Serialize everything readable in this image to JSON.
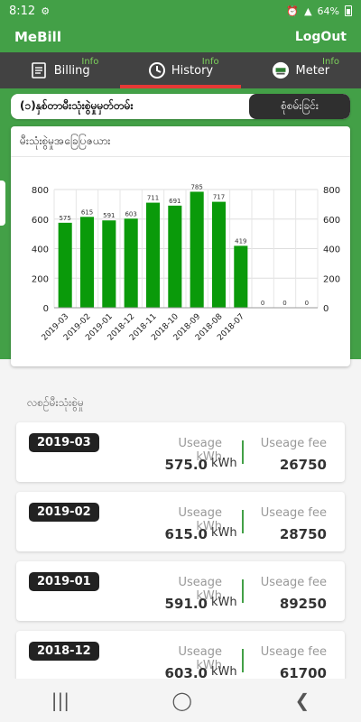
{
  "status": {
    "time": "8:12",
    "battery": "64%"
  },
  "app": {
    "title": "MeBill",
    "logout": "LogOut"
  },
  "tabs": [
    {
      "label": "Billing",
      "badge": "Info",
      "icon": "billing-icon"
    },
    {
      "label": "History",
      "badge": "Info",
      "icon": "history-icon",
      "active": true
    },
    {
      "label": "Meter",
      "badge": "Info",
      "icon": "meter-icon"
    }
  ],
  "search": {
    "label": "(၁)နှစ်တာမီးသုံးစွဲမှုမှတ်တမ်း",
    "button": "စုံစမ်းခြင်း"
  },
  "chart_title": "မီးသုံးစွဲမှုအခြေပြဇယား",
  "chart_data": {
    "type": "bar",
    "categories": [
      "2019-03",
      "2019-02",
      "2019-01",
      "2018-12",
      "2018-11",
      "2018-10",
      "2018-09",
      "2018-08",
      "2018-07",
      "",
      "",
      ""
    ],
    "values": [
      575,
      615,
      591,
      603,
      711,
      691,
      785,
      717,
      419,
      0,
      0,
      0
    ],
    "ylim": [
      0,
      800
    ],
    "yticks": [
      0,
      200,
      400,
      600,
      800
    ],
    "color": "#0a9a0a",
    "grid": true
  },
  "history_title": "လစဉ်မီးသုံးစွဲမှု",
  "labels": {
    "usage": "Useage kWh",
    "fee": "Useage fee",
    "unit": "kWh"
  },
  "history": [
    {
      "month": "2019-03",
      "usage": "575.0",
      "fee": "26750"
    },
    {
      "month": "2019-02",
      "usage": "615.0",
      "fee": "28750"
    },
    {
      "month": "2019-01",
      "usage": "591.0",
      "fee": "89250"
    },
    {
      "month": "2018-12",
      "usage": "603.0",
      "fee": "61700"
    }
  ],
  "colors": {
    "accent": "#43a047",
    "tab_bg": "#424242",
    "active_tab": "#e53935"
  }
}
